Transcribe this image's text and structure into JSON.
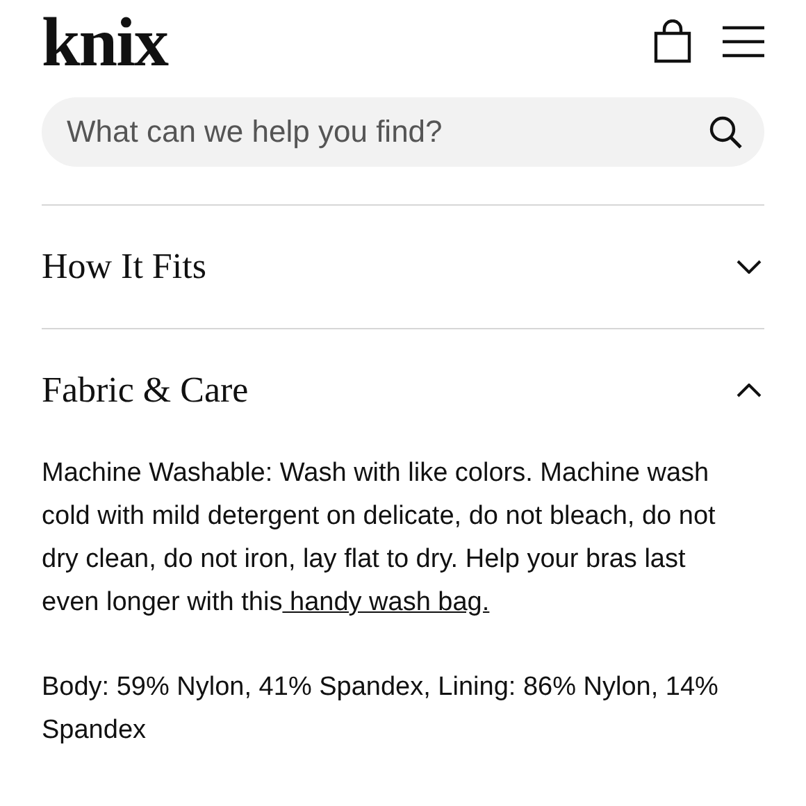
{
  "header": {
    "logo": "knix"
  },
  "search": {
    "placeholder": "What can we help you find?"
  },
  "sections": [
    {
      "title": "How It Fits",
      "expanded": false
    },
    {
      "title": "Fabric & Care",
      "expanded": true,
      "paragraphs": [
        {
          "text": "Machine Washable: Wash with like colors. Machine wash cold with mild detergent on delicate, do not bleach, do not dry clean, do not iron, lay flat to dry. Help your bras last even longer with this",
          "link": " handy wash bag."
        },
        {
          "text": "Body: 59% Nylon, 41% Spandex, Lining: 86% Nylon, 14% Spandex"
        }
      ]
    }
  ]
}
